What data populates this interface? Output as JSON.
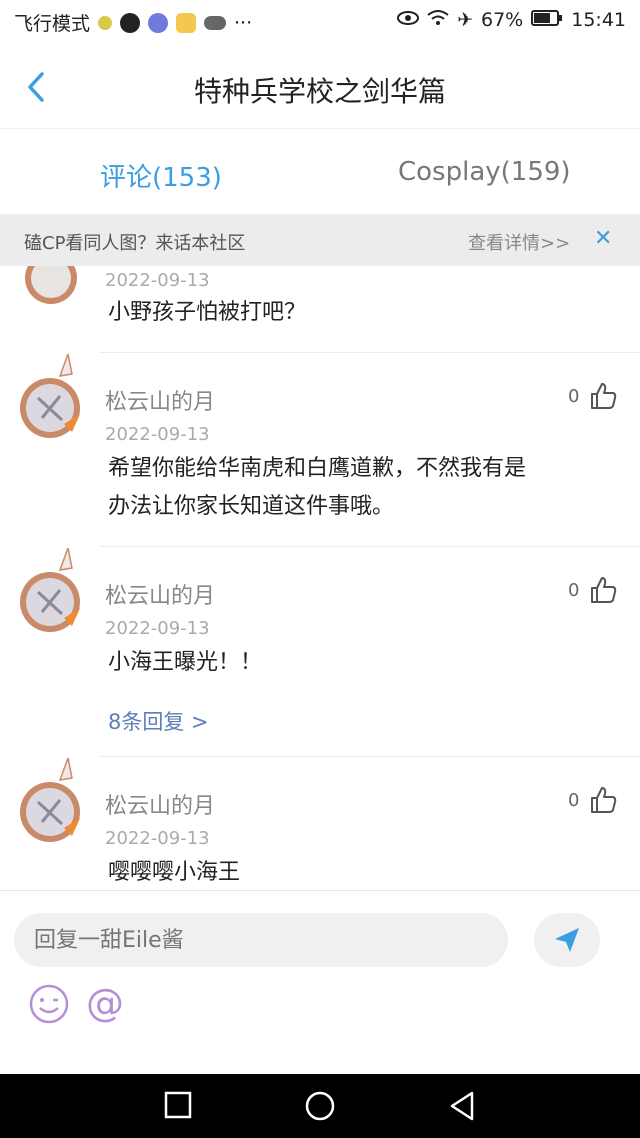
{
  "status_bar": {
    "carrier": "飞行模式",
    "more": "···",
    "battery": "67%",
    "time": "15:41"
  },
  "header": {
    "title": "特种兵学校之剑华篇"
  },
  "tabs": [
    {
      "label": "评论(153)",
      "active": true
    },
    {
      "label": "Cosplay(159)",
      "active": false
    }
  ],
  "banner": {
    "text": "磕CP看同人图？来话本社区",
    "more": "查看详情>>",
    "close": "✕"
  },
  "comments": [
    {
      "date": "2022-09-13",
      "text": "小野孩子怕被打吧？"
    },
    {
      "user": "松云山的月",
      "likes": "0",
      "date": "2022-09-13",
      "text_lines": [
        "希望你能给华南虎和白鹰道歉，不然我有是",
        "办法让你家长知道这件事哦。"
      ]
    },
    {
      "user": "松云山的月",
      "likes": "0",
      "date": "2022-09-13",
      "text": "小海王曝光！！",
      "replies": "8条回复 >"
    },
    {
      "user": "松云山的月",
      "likes": "0",
      "date": "2022-09-13",
      "text": "嘤嘤嘤小海王"
    }
  ],
  "input": {
    "placeholder": "回复一甜Eile酱",
    "at": "@"
  },
  "colors": {
    "accent": "#3a9fe0",
    "link": "#5b7fb8",
    "emoji": "#b38fd6"
  },
  "icons": [
    "back-icon",
    "send-icon",
    "like-icon",
    "emoji-icon",
    "close-icon",
    "square-nav-icon",
    "circle-nav-icon",
    "triangle-nav-icon"
  ]
}
